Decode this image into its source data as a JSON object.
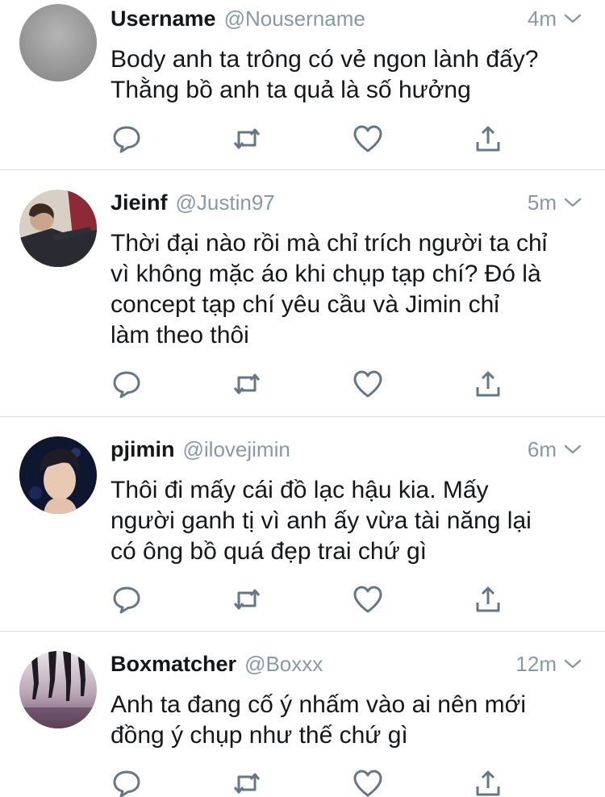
{
  "tweets": [
    {
      "display_name": "Username",
      "handle": "@Nousername",
      "time": "4m",
      "avatar": "blank-grey-avatar",
      "lines": [
        "Body anh ta trông có vẻ ngon lành đấy?",
        "Thằng bồ anh ta quả là số hưởng"
      ]
    },
    {
      "display_name": "Jieinf",
      "handle": "@Justin97",
      "time": "5m",
      "avatar": "person-photo-avatar",
      "lines": [
        "Thời đại nào rồi mà chỉ trích người ta chỉ",
        "vì không mặc áo khi chụp tạp chí? Đó là",
        "concept tạp chí yêu cầu và Jimin chỉ",
        "làm theo thôi"
      ]
    },
    {
      "display_name": "pjimin",
      "handle": "@ilovejimin",
      "time": "6m",
      "avatar": "portrait-photo-avatar",
      "lines": [
        "Thôi đi mấy cái đồ lạc hậu kia. Mấy",
        "người ganh tị vì anh ấy vừa tài năng lại",
        "có ông bồ quá đẹp trai chứ gì"
      ]
    },
    {
      "display_name": "Boxmatcher",
      "handle": "@Boxxx",
      "time": "12m",
      "avatar": "silhouettes-photo-avatar",
      "lines": [
        "Anh ta đang cố ý nhấm vào ai nên mới",
        "đồng ý chụp như thế chứ gì"
      ]
    }
  ],
  "actions": [
    "reply-icon",
    "retweet-icon",
    "like-icon",
    "share-icon"
  ],
  "colors": {
    "text": "#14171a",
    "secondary": "#8899a6",
    "icon": "#657786",
    "divider": "#d6dbe0"
  }
}
